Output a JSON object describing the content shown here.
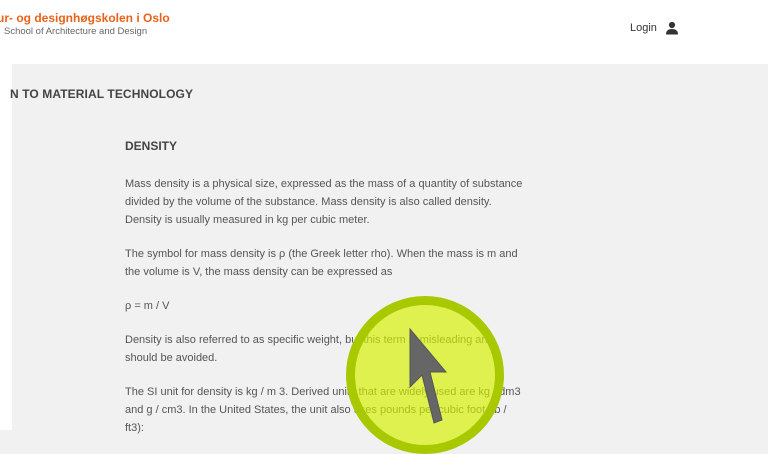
{
  "header": {
    "school_name": "ur- og designhøgskolen i Oslo",
    "school_sub": "School of Architecture and Design",
    "login_label": "Login",
    "icons": {
      "login": "user-icon"
    }
  },
  "course": {
    "title": "N TO MATERIAL TECHNOLOGY"
  },
  "article": {
    "heading": "DENSITY",
    "paragraphs": [
      "Mass density is a physical size, expressed as the mass of a quantity of substance divided by the volume of the substance. Mass density is also called density. Density is usually measured in kg per cubic meter.",
      "The symbol for mass density is ρ (the Greek letter rho). When the mass is m and the volume is V, the mass density can be expressed as",
      "ρ = m / V",
      "Density is also referred to as specific weight, but this term is misleading and should be avoided.",
      "The SI unit for density is kg / m 3. Derived units that are widely used are kg / dm3 and g / cm3. In the United States, the unit also uses pounds per cubic foot (lb / ft3):"
    ]
  },
  "colors": {
    "brand": "#e8621b",
    "cursor_highlight": "#d6f000",
    "cursor_ring": "#a8c800",
    "cursor_arrow": "#666666"
  }
}
